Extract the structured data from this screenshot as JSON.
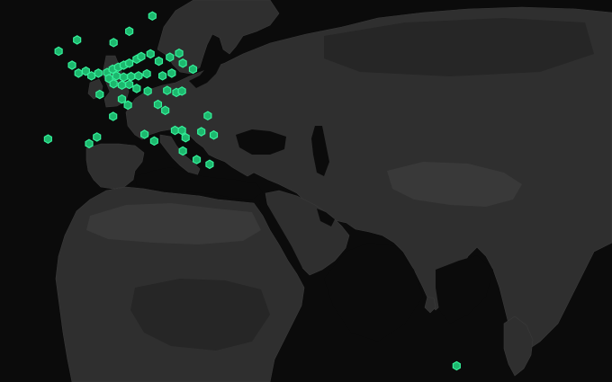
{
  "map": {
    "background_color": "#0b0b0b",
    "land_color": "#2f2f2f",
    "marker_fill": "#1db86e",
    "marker_stroke": "#35f09a",
    "marker_shape": "hexagon"
  },
  "markers": [
    {
      "lon": 14.0,
      "lat": 59.6
    },
    {
      "lon": 9.0,
      "lat": 57.3
    },
    {
      "lon": 5.6,
      "lat": 55.6
    },
    {
      "lon": -2.3,
      "lat": 56.0
    },
    {
      "lon": -6.3,
      "lat": 54.3
    },
    {
      "lon": -3.4,
      "lat": 52.2
    },
    {
      "lon": -2.0,
      "lat": 51.0
    },
    {
      "lon": -0.4,
      "lat": 51.3
    },
    {
      "lon": 0.8,
      "lat": 50.6
    },
    {
      "lon": 2.3,
      "lat": 51.0
    },
    {
      "lon": 4.2,
      "lat": 51.1
    },
    {
      "lon": 5.4,
      "lat": 51.6
    },
    {
      "lon": 6.6,
      "lat": 51.9
    },
    {
      "lon": 7.8,
      "lat": 52.2
    },
    {
      "lon": 9.0,
      "lat": 52.5
    },
    {
      "lon": 10.6,
      "lat": 53.1
    },
    {
      "lon": 11.6,
      "lat": 53.5
    },
    {
      "lon": 13.6,
      "lat": 53.9
    },
    {
      "lon": 15.4,
      "lat": 52.8
    },
    {
      "lon": 17.8,
      "lat": 53.4
    },
    {
      "lon": 19.8,
      "lat": 54.0
    },
    {
      "lon": 20.6,
      "lat": 52.5
    },
    {
      "lon": 22.8,
      "lat": 51.6
    },
    {
      "lon": 18.2,
      "lat": 51.0
    },
    {
      "lon": 16.2,
      "lat": 50.6
    },
    {
      "lon": 4.6,
      "lat": 50.2
    },
    {
      "lon": 6.2,
      "lat": 50.6
    },
    {
      "lon": 7.8,
      "lat": 50.4
    },
    {
      "lon": 9.4,
      "lat": 50.5
    },
    {
      "lon": 11.0,
      "lat": 50.6
    },
    {
      "lon": 12.8,
      "lat": 50.9
    },
    {
      "lon": 5.6,
      "lat": 49.4
    },
    {
      "lon": 7.4,
      "lat": 49.2
    },
    {
      "lon": 9.0,
      "lat": 49.3
    },
    {
      "lon": 10.6,
      "lat": 48.7
    },
    {
      "lon": 13.0,
      "lat": 48.3
    },
    {
      "lon": 17.2,
      "lat": 48.4
    },
    {
      "lon": 19.2,
      "lat": 48.1
    },
    {
      "lon": 20.4,
      "lat": 48.3
    },
    {
      "lon": 2.6,
      "lat": 47.8
    },
    {
      "lon": 7.4,
      "lat": 47.1
    },
    {
      "lon": 8.7,
      "lat": 46.2
    },
    {
      "lon": 15.2,
      "lat": 46.3
    },
    {
      "lon": 16.8,
      "lat": 45.4
    },
    {
      "lon": 5.5,
      "lat": 44.5
    },
    {
      "lon": 26.0,
      "lat": 44.6
    },
    {
      "lon": -8.6,
      "lat": 41.1
    },
    {
      "lon": 2.0,
      "lat": 41.4
    },
    {
      "lon": 0.3,
      "lat": 40.4
    },
    {
      "lon": 12.3,
      "lat": 41.8
    },
    {
      "lon": 14.4,
      "lat": 40.8
    },
    {
      "lon": 18.9,
      "lat": 42.4
    },
    {
      "lon": 20.4,
      "lat": 42.4
    },
    {
      "lon": 21.2,
      "lat": 41.3
    },
    {
      "lon": 24.6,
      "lat": 42.2
    },
    {
      "lon": 27.3,
      "lat": 41.7
    },
    {
      "lon": 20.6,
      "lat": 39.3
    },
    {
      "lon": 23.6,
      "lat": 38.0
    },
    {
      "lon": 26.4,
      "lat": 37.3
    },
    {
      "lon": 79.9,
      "lat": 7.0
    }
  ]
}
